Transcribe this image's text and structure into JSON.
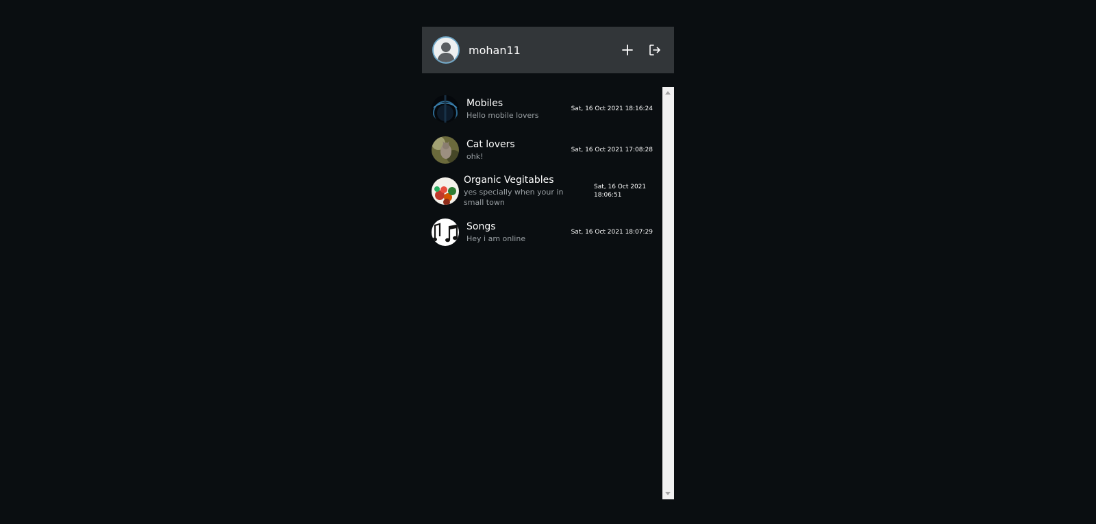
{
  "header": {
    "username": "mohan11",
    "add_icon": "plus-icon",
    "logout_icon": "logout-icon"
  },
  "chats": [
    {
      "name": "Mobiles",
      "message": "Hello mobile lovers",
      "time": "Sat, 16 Oct 2021 18:16:24",
      "avatar": "phone-image"
    },
    {
      "name": "Cat lovers",
      "message": "ohk!",
      "time": "Sat, 16 Oct 2021 17:08:28",
      "avatar": "cat-image"
    },
    {
      "name": "Organic Vegitables",
      "message": "yes specially when your in small town",
      "time": "Sat, 16 Oct 2021 18:06:51",
      "avatar": "vegetables-image"
    },
    {
      "name": "Songs",
      "message": "Hey i am online",
      "time": "Sat, 16 Oct 2021 18:07:29",
      "avatar": "music-notes-image"
    }
  ],
  "colors": {
    "background": "#0a0e11",
    "header": "#323639",
    "secondary_text": "#9aa0a4",
    "scrollbar": "#f1f1f1"
  }
}
